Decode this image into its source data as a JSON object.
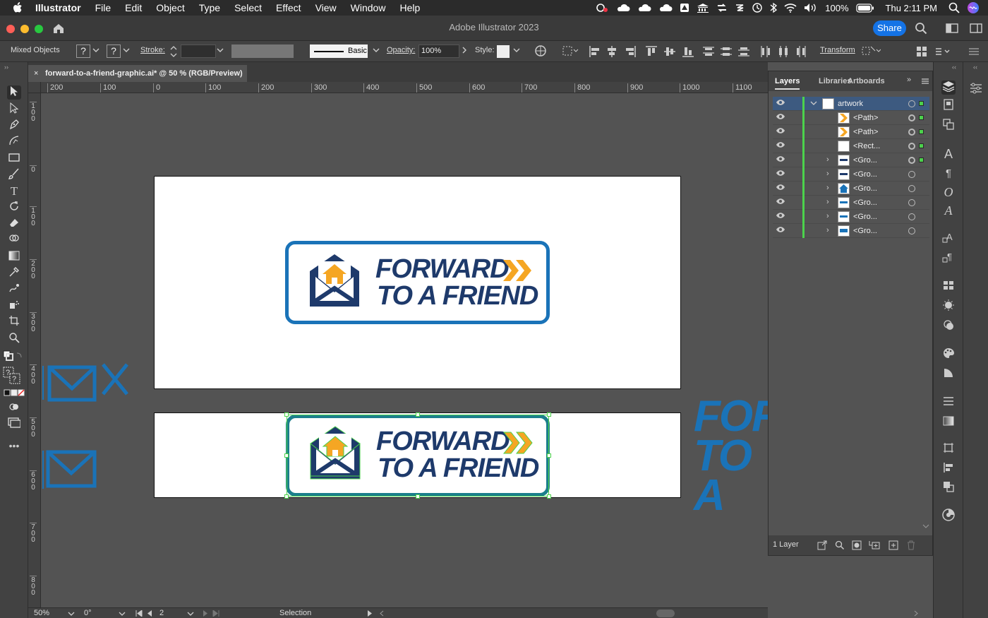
{
  "menubar": {
    "app": "Illustrator",
    "items": [
      "File",
      "Edit",
      "Object",
      "Type",
      "Select",
      "Effect",
      "View",
      "Window",
      "Help"
    ],
    "battery": "100%",
    "clock": "Thu 2:11 PM"
  },
  "window": {
    "title": "Adobe Illustrator 2023",
    "share_label": "Share"
  },
  "controlbar": {
    "selection_type": "Mixed Objects",
    "unknown_glyph": "?",
    "stroke_label": "Stroke:",
    "brush_label": "Basic",
    "opacity_label": "Opacity:",
    "opacity_value": "100%",
    "style_label": "Style:",
    "transform_label": "Transform"
  },
  "document": {
    "tab_title": "forward-to-a-friend-graphic.ai* @ 50 % (RGB/Preview)",
    "close_glyph": "×"
  },
  "rulers": {
    "h_ticks": [
      "200",
      "100",
      "0",
      "100",
      "200",
      "300",
      "400",
      "500",
      "600",
      "700",
      "800",
      "900",
      "1000",
      "1100"
    ],
    "v_ticks": [
      "1\n0\n0",
      "0",
      "1\n0\n0",
      "2\n0\n0",
      "3\n0\n0",
      "4\n0\n0",
      "5\n0\n0",
      "6\n0\n0",
      "7\n0\n0",
      "8\n0\n0"
    ]
  },
  "artwork": {
    "line1": "FORWARD",
    "line2": "TO A FRIEND",
    "brand_blue": "#1a73b8",
    "navy": "#1e3a6b",
    "orange": "#f5a623",
    "offcanvas_text1": "FOR",
    "offcanvas_text2": "TO A"
  },
  "statusbar": {
    "zoom": "50%",
    "rotation": "0°",
    "artboard": "2",
    "tool": "Selection"
  },
  "layers_panel": {
    "tabs": [
      "Layers",
      "Libraries",
      "Artboards"
    ],
    "rows": [
      {
        "name": "artwork",
        "kind": "layer"
      },
      {
        "name": "<Path>",
        "kind": "path"
      },
      {
        "name": "<Path>",
        "kind": "path"
      },
      {
        "name": "<Rect...",
        "kind": "rect"
      },
      {
        "name": "<Gro...",
        "kind": "group"
      },
      {
        "name": "<Gro...",
        "kind": "group"
      },
      {
        "name": "<Gro...",
        "kind": "group"
      },
      {
        "name": "<Gro...",
        "kind": "group"
      },
      {
        "name": "<Gro...",
        "kind": "group"
      },
      {
        "name": "<Gro...",
        "kind": "group"
      }
    ],
    "footer": "1 Layer"
  }
}
